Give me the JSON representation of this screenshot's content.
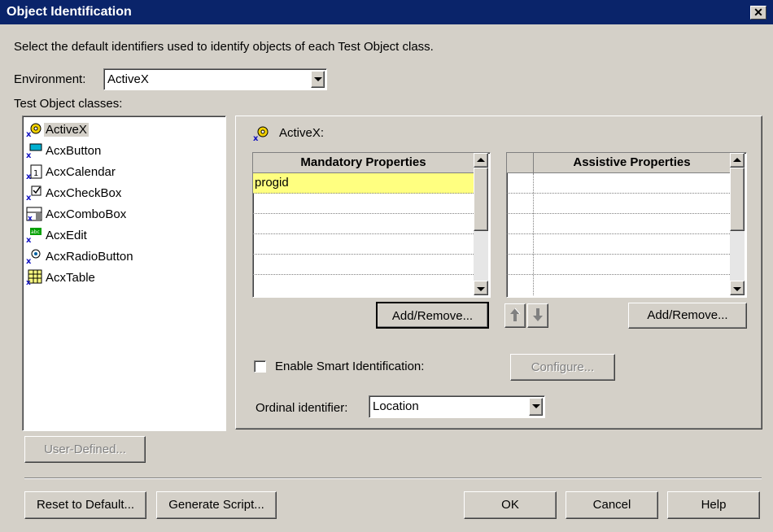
{
  "window": {
    "title": "Object Identification",
    "close_glyph": "✕"
  },
  "description": "Select the default identifiers used to identify objects of each Test Object class.",
  "environment": {
    "label": "Environment:",
    "value": "ActiveX"
  },
  "classes": {
    "label": "Test Object classes:",
    "items": [
      {
        "label": "ActiveX",
        "icon": "activex-gear-icon"
      },
      {
        "label": "AcxButton",
        "icon": "acx-button-icon"
      },
      {
        "label": "AcxCalendar",
        "icon": "acx-calendar-icon"
      },
      {
        "label": "AcxCheckBox",
        "icon": "acx-checkbox-icon"
      },
      {
        "label": "AcxComboBox",
        "icon": "acx-combobox-icon"
      },
      {
        "label": "AcxEdit",
        "icon": "acx-edit-icon"
      },
      {
        "label": "AcxRadioButton",
        "icon": "acx-radiobutton-icon"
      },
      {
        "label": "AcxTable",
        "icon": "acx-table-icon"
      }
    ],
    "selected": "ActiveX"
  },
  "detail": {
    "class_label": "ActiveX:",
    "mandatory": {
      "header": "Mandatory Properties",
      "rows": [
        "progid",
        "",
        "",
        "",
        "",
        ""
      ]
    },
    "assistive": {
      "header": "Assistive Properties",
      "rows": [
        "",
        "",
        "",
        "",
        "",
        ""
      ]
    },
    "add_remove_label": "Add/Remove...",
    "smart_id": {
      "label": "Enable Smart Identification:",
      "checked": false
    },
    "configure_label": "Configure...",
    "ordinal": {
      "label": "Ordinal identifier:",
      "value": "Location"
    }
  },
  "buttons": {
    "user_defined": "User-Defined...",
    "reset": "Reset to Default...",
    "generate": "Generate Script...",
    "ok": "OK",
    "cancel": "Cancel",
    "help": "Help"
  },
  "colors": {
    "title_bar": "#0a246a",
    "face": "#d4d0c8",
    "highlight_row": "#ffff80"
  }
}
